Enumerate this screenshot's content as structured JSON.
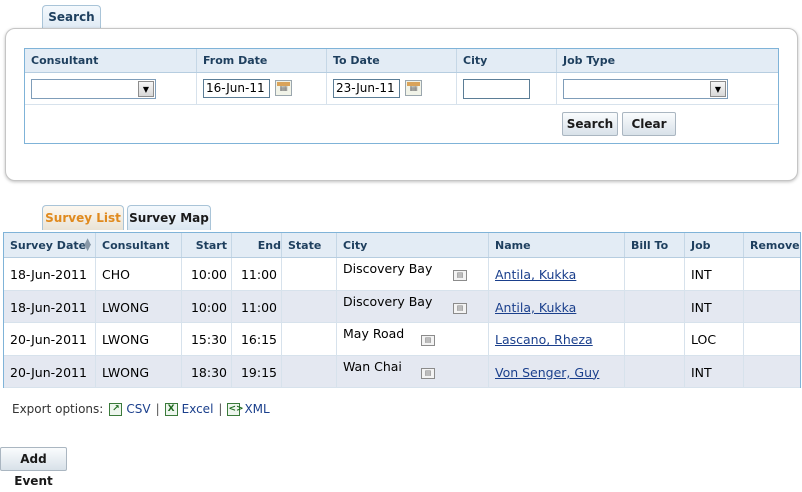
{
  "search": {
    "tab_label": "Search",
    "columns": [
      "Consultant",
      "From Date",
      "To Date",
      "City",
      "Job Type"
    ],
    "consultant_value": "",
    "from_date": "16-Jun-11",
    "to_date": "23-Jun-11",
    "city_value": "",
    "job_type_value": "",
    "search_label": "Search",
    "clear_label": "Clear"
  },
  "tabs": [
    {
      "label": "Survey List",
      "active": true
    },
    {
      "label": "Survey Map",
      "active": false
    }
  ],
  "table": {
    "headers": [
      "Survey Date",
      "Consultant",
      "Start",
      "End",
      "State",
      "City",
      "Name",
      "Bill To",
      "Job",
      "Remove"
    ],
    "rows": [
      {
        "date": "18-Jun-2011",
        "consultant": "CHO",
        "start": "10:00",
        "end": "11:00",
        "state": "",
        "city": "Discovery Bay",
        "name": "Antila, Kukka",
        "bill_to": "",
        "job": "INT",
        "remove": ""
      },
      {
        "date": "18-Jun-2011",
        "consultant": "LWONG",
        "start": "10:00",
        "end": "11:00",
        "state": "",
        "city": "Discovery Bay",
        "name": "Antila, Kukka",
        "bill_to": "",
        "job": "INT",
        "remove": ""
      },
      {
        "date": "20-Jun-2011",
        "consultant": "LWONG",
        "start": "15:30",
        "end": "16:15",
        "state": "",
        "city": "May Road",
        "name": "Lascano, Rheza",
        "bill_to": "",
        "job": "LOC",
        "remove": ""
      },
      {
        "date": "20-Jun-2011",
        "consultant": "LWONG",
        "start": "18:30",
        "end": "19:15",
        "state": "",
        "city": "Wan Chai",
        "name": "Von Senger, Guy",
        "bill_to": "",
        "job": "INT",
        "remove": ""
      }
    ]
  },
  "export": {
    "label": "Export options:",
    "options": [
      "CSV",
      "Excel",
      "XML"
    ],
    "separator": "|"
  },
  "add_event_label": "Add Event"
}
